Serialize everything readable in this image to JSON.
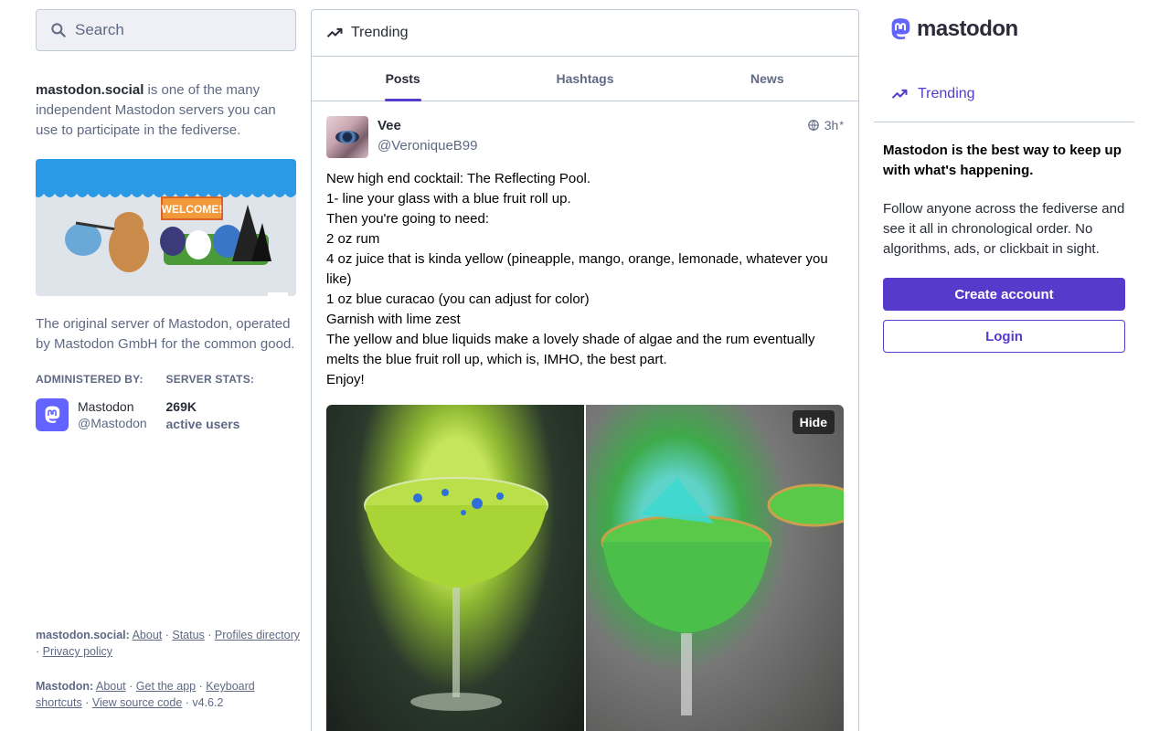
{
  "search": {
    "placeholder": "Search"
  },
  "server": {
    "domain": "mastodon.social",
    "intro": " is one of the many independent Mastodon servers you can use to participate in the fediverse.",
    "description": "The original server of Mastodon, operated by Mastodon GmbH for the common good.",
    "hero_text": "WELCOME!",
    "administered_label": "ADMINISTERED BY:",
    "stats_label": "SERVER STATS:",
    "admin_name": "Mastodon",
    "admin_handle": "@Mastodon",
    "active_users_count": "269K",
    "active_users_label": "active users"
  },
  "footer": {
    "server_prefix": "mastodon.social:",
    "server_links": [
      "About",
      "Status",
      "Profiles directory",
      "Privacy policy"
    ],
    "mastodon_prefix": "Mastodon:",
    "mastodon_links": [
      "About",
      "Get the app",
      "Keyboard shortcuts",
      "View source code"
    ],
    "version": "v4.6.2"
  },
  "column": {
    "title": "Trending",
    "tabs": [
      {
        "label": "Posts",
        "active": true
      },
      {
        "label": "Hashtags",
        "active": false
      },
      {
        "label": "News",
        "active": false
      }
    ]
  },
  "post": {
    "display_name": "Vee",
    "handle": "@VeroniqueB99",
    "time": "3h",
    "edited_marker": "*",
    "visibility_icon": "globe-icon",
    "lines": [
      "New high end cocktail: The Reflecting Pool.",
      "1- line your glass with a blue fruit roll up.",
      "Then you're going to need:",
      "2 oz rum",
      "4 oz juice that is kinda yellow (pineapple, mango, orange, lemonade, whatever you like)",
      "1 oz blue curacao (you can adjust for color)",
      "Garnish with lime zest",
      "The yellow and blue liquids make a lovely shade of algae and the rum eventually melts the blue fruit roll up, which is, IMHO, the best part.",
      "Enjoy!"
    ],
    "hide_label": "Hide"
  },
  "sidebar": {
    "logo_text": "mastodon",
    "nav_trending": "Trending",
    "signup_head": "Mastodon is the best way to keep up with what's happening.",
    "signup_body": "Follow anyone across the fediverse and see it all in chronological order. No algorithms, ads, or clickbait in sight.",
    "create_account": "Create account",
    "login": "Login"
  },
  "colors": {
    "accent": "#563acc",
    "brand": "#6364ff",
    "muted": "#606984",
    "text": "#282c37",
    "border": "#c0cdd9"
  }
}
